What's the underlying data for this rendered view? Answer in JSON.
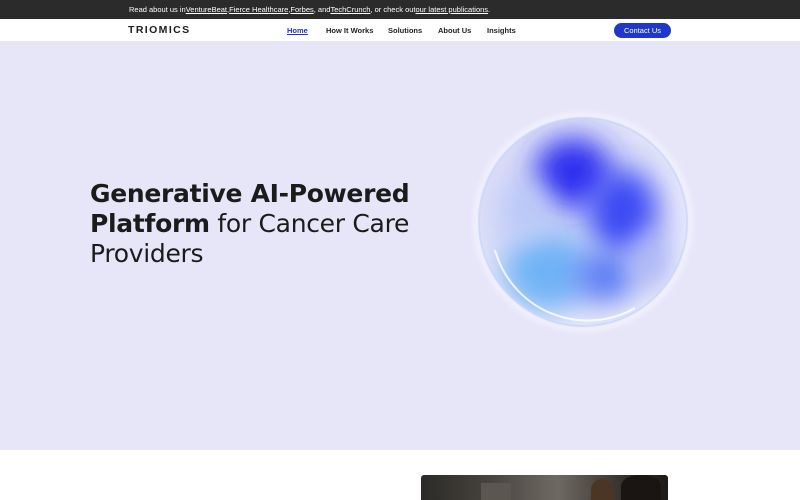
{
  "announcement": {
    "prefix": "Read about us in ",
    "links": [
      "VentureBeat",
      "Fierce Healthcare",
      "Forbes",
      "TechCrunch"
    ],
    "sep1": ", ",
    "sep2": ", ",
    "sep3": ", and ",
    "middle": ", or check out ",
    "publications_link": "our latest publications",
    "suffix": "."
  },
  "nav": {
    "logo": "TRIOMICS",
    "items": [
      {
        "label": "Home",
        "active": true
      },
      {
        "label": "How It Works",
        "active": false
      },
      {
        "label": "Solutions",
        "active": false
      },
      {
        "label": "About Us",
        "active": false
      },
      {
        "label": "Insights",
        "active": false
      }
    ],
    "cta": "Contact Us"
  },
  "hero": {
    "title_bold": "Generative AI-Powered Platform",
    "title_rest": " for Cancer Care Providers",
    "visual": "gradient-sphere-illustration"
  },
  "colors": {
    "announcement_bg": "#2b2b2b",
    "hero_bg": "#e7e6f9",
    "accent": "#1f38c9",
    "active_link": "#2332b8"
  }
}
